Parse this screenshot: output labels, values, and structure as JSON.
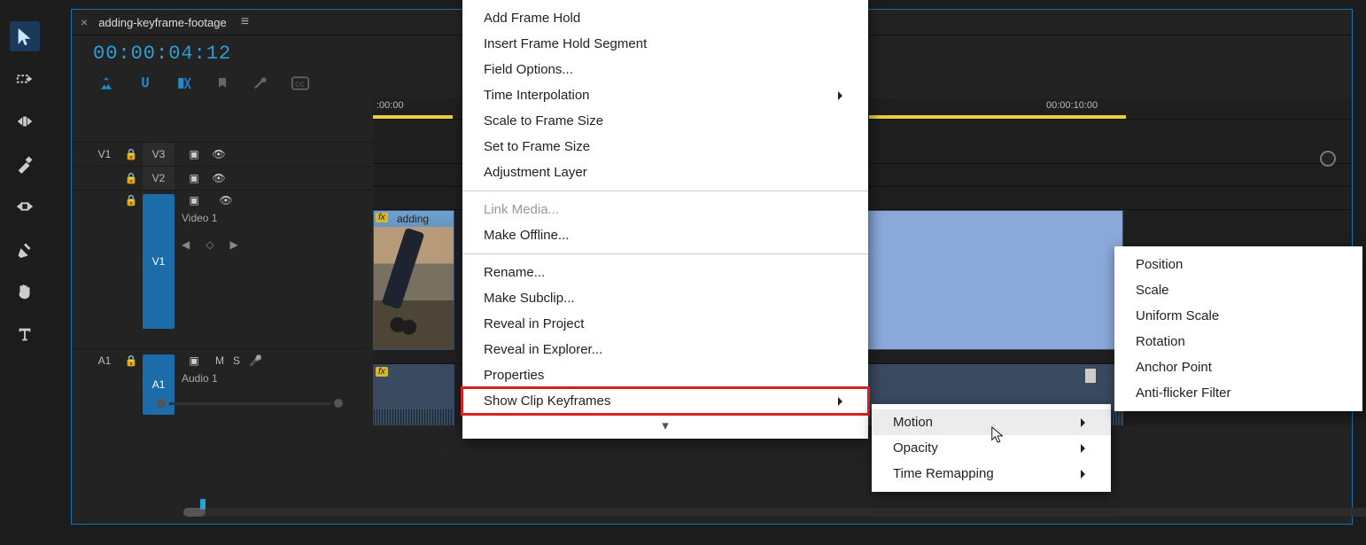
{
  "panel": {
    "title": "adding-keyframe-footage",
    "timecode": "00:00:04:12"
  },
  "ruler": {
    "tick0": ":00:00",
    "tick1": "00:00:10:00"
  },
  "tracks": {
    "v3": {
      "src": "",
      "name": "V3"
    },
    "v2": {
      "src": "",
      "name": "V2"
    },
    "v1": {
      "src": "V1",
      "name": "V1",
      "label": "Video 1"
    },
    "a1": {
      "src": "A1",
      "name": "A1",
      "label": "Audio 1"
    }
  },
  "clips": {
    "v1": {
      "fx": "fx",
      "label": "adding"
    },
    "a1": {
      "fx": "fx"
    }
  },
  "menu_main": {
    "items": [
      {
        "label": "Add Frame Hold"
      },
      {
        "label": "Insert Frame Hold Segment"
      },
      {
        "label": "Field Options..."
      },
      {
        "label": "Time Interpolation",
        "submenu": true
      },
      {
        "label": "Scale to Frame Size"
      },
      {
        "label": "Set to Frame Size"
      },
      {
        "label": "Adjustment Layer"
      },
      {
        "sep": true
      },
      {
        "label": "Link Media...",
        "disabled": true
      },
      {
        "label": "Make Offline..."
      },
      {
        "sep": true
      },
      {
        "label": "Rename..."
      },
      {
        "label": "Make Subclip..."
      },
      {
        "label": "Reveal in Project"
      },
      {
        "label": "Reveal in Explorer..."
      },
      {
        "label": "Properties"
      },
      {
        "label": "Show Clip Keyframes",
        "submenu": true,
        "highlight": true
      }
    ]
  },
  "menu_sub1": {
    "items": [
      {
        "label": "Motion",
        "selected": true
      },
      {
        "label": "Opacity"
      },
      {
        "label": "Time Remapping"
      }
    ]
  },
  "menu_sub2": {
    "items": [
      {
        "label": "Position"
      },
      {
        "label": "Scale"
      },
      {
        "label": "Uniform Scale"
      },
      {
        "label": "Rotation"
      },
      {
        "label": "Anchor Point"
      },
      {
        "label": "Anti-flicker Filter"
      }
    ]
  }
}
